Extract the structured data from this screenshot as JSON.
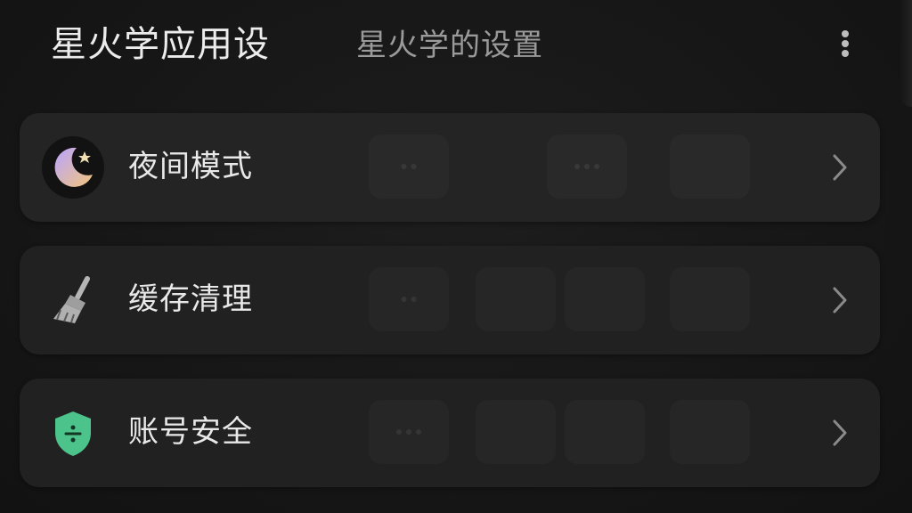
{
  "header": {
    "title": "星火学应用设",
    "subtitle": "星火学的设置",
    "more_icon": "more-vertical-icon"
  },
  "settings": {
    "items": [
      {
        "label": "夜间模式",
        "icon": "moon-star-icon"
      },
      {
        "label": "缓存清理",
        "icon": "broom-icon"
      },
      {
        "label": "账号安全",
        "icon": "shield-icon"
      }
    ],
    "chevron_icon": "chevron-right-icon"
  },
  "colors": {
    "background": "#161616",
    "card": "#212121",
    "title_text": "#ececec",
    "subtitle_text": "#9a9a9a",
    "moon_gradient_start": "#b8a4ff",
    "moon_gradient_end": "#f2c57c",
    "shield_green": "#4cc38a"
  }
}
